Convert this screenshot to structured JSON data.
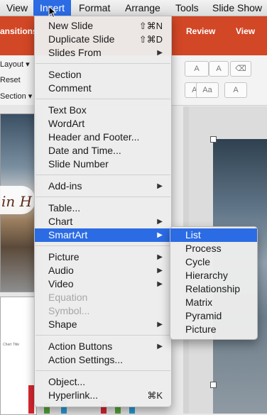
{
  "menubar": {
    "items": [
      "View",
      "Insert",
      "Format",
      "Arrange",
      "Tools",
      "Slide Show"
    ],
    "active_index": 1
  },
  "app": {
    "ribbon_tabs_left": "ansitions",
    "ribbon_tabs_right": [
      "Review",
      "View"
    ],
    "left_controls": [
      "Layout",
      "Reset",
      "Section"
    ],
    "thumb_title_text": "in H",
    "thumb_chart_title": "Chart Title",
    "accent_color": "#d24726"
  },
  "insert_menu": {
    "groups": [
      [
        {
          "label": "New Slide",
          "shortcut": "⇧⌘N"
        },
        {
          "label": "Duplicate Slide",
          "shortcut": "⇧⌘D"
        },
        {
          "label": "Slides From",
          "submenu": true
        }
      ],
      [
        {
          "label": "Section"
        },
        {
          "label": "Comment"
        }
      ],
      [
        {
          "label": "Text Box"
        },
        {
          "label": "WordArt"
        },
        {
          "label": "Header and Footer..."
        },
        {
          "label": "Date and Time..."
        },
        {
          "label": "Slide Number"
        }
      ],
      [
        {
          "label": "Add-ins",
          "submenu": true
        }
      ],
      [
        {
          "label": "Table..."
        },
        {
          "label": "Chart",
          "submenu": true
        },
        {
          "label": "SmartArt",
          "submenu": true,
          "highlight": true
        }
      ],
      [
        {
          "label": "Picture",
          "submenu": true
        },
        {
          "label": "Audio",
          "submenu": true
        },
        {
          "label": "Video",
          "submenu": true
        },
        {
          "label": "Equation",
          "disabled": true
        },
        {
          "label": "Symbol...",
          "disabled": true
        },
        {
          "label": "Shape",
          "submenu": true
        }
      ],
      [
        {
          "label": "Action Buttons",
          "submenu": true
        },
        {
          "label": "Action Settings..."
        }
      ],
      [
        {
          "label": "Object..."
        },
        {
          "label": "Hyperlink...",
          "shortcut": "⌘K"
        }
      ]
    ]
  },
  "smartart_submenu": {
    "items": [
      "List",
      "Process",
      "Cycle",
      "Hierarchy",
      "Relationship",
      "Matrix",
      "Pyramid",
      "Picture"
    ],
    "highlight_index": 0
  }
}
